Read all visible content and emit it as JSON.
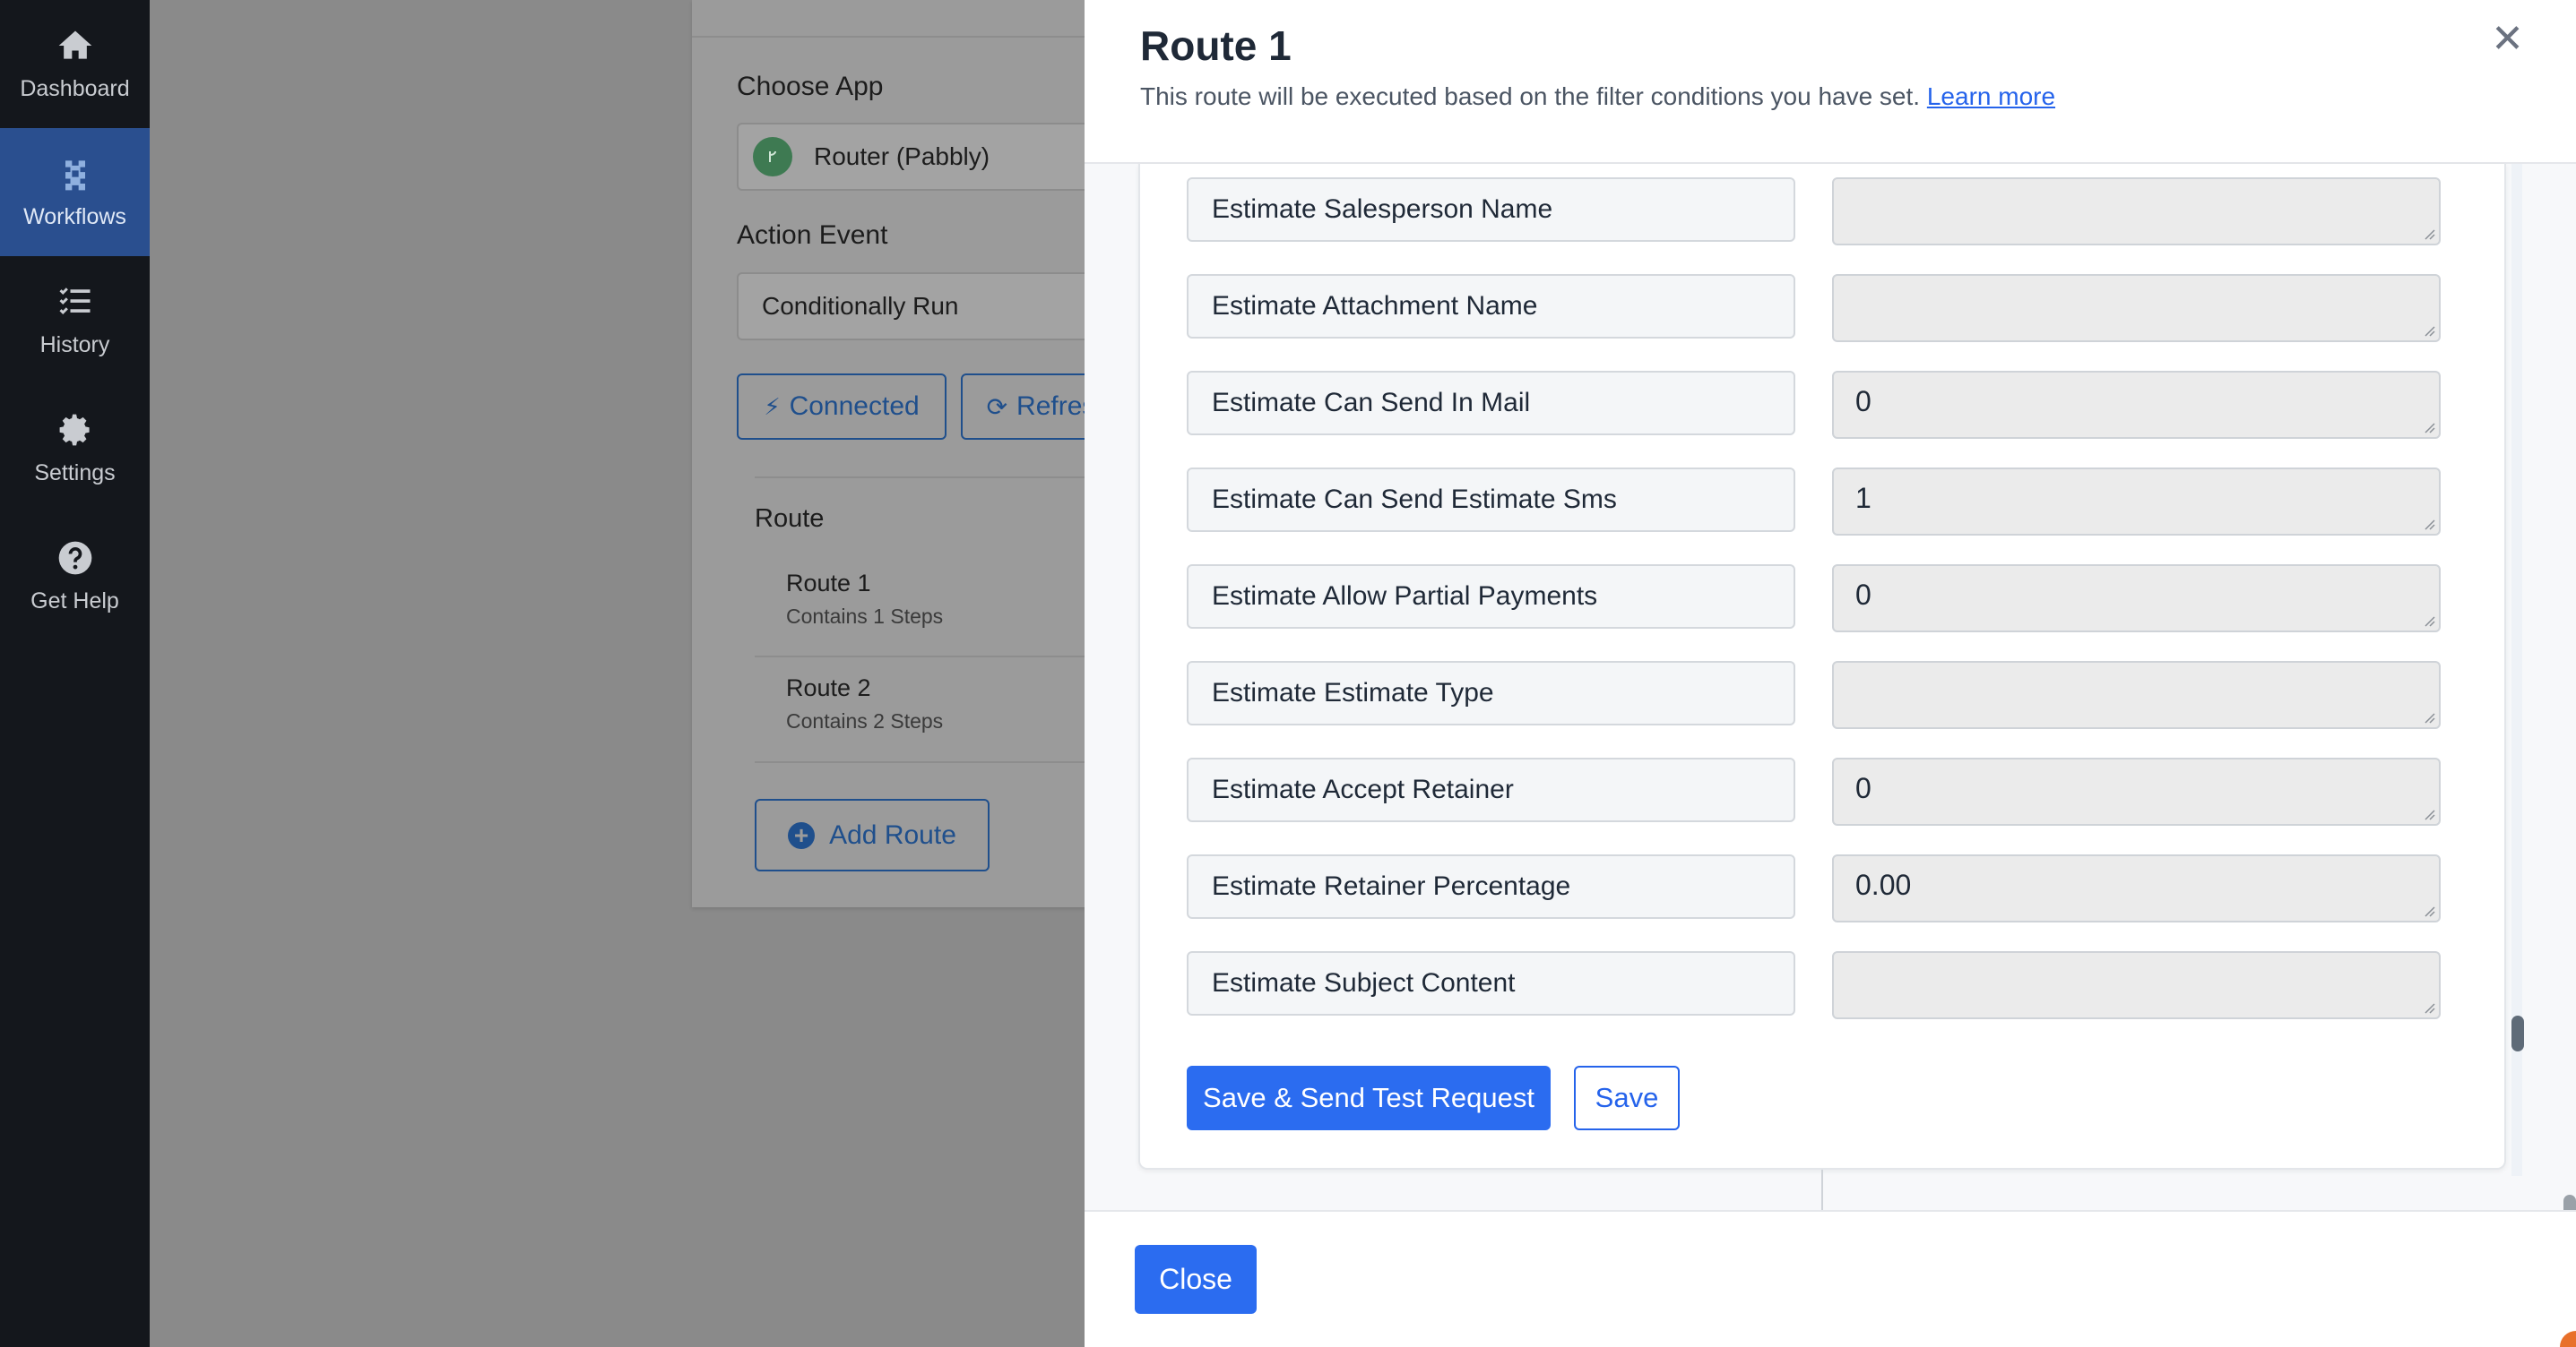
{
  "sidebar": {
    "items": [
      {
        "label": "Dashboard",
        "icon": "home-icon",
        "active": false
      },
      {
        "label": "Workflows",
        "icon": "workflow-icon",
        "active": true
      },
      {
        "label": "History",
        "icon": "history-list-icon",
        "active": false
      },
      {
        "label": "Settings",
        "icon": "gear-icon",
        "active": false
      },
      {
        "label": "Get Help",
        "icon": "help-icon",
        "active": false
      }
    ]
  },
  "background_panel": {
    "choose_app_label": "Choose App",
    "app_value": "Router (Pabbly)",
    "action_event_label": "Action Event",
    "action_event_value": "Conditionally Run",
    "connected_label": "Connected",
    "refresh_label": "Refresh Fields",
    "route_heading": "Route",
    "routes": [
      {
        "title": "Route 1",
        "steps": "Contains 1 Steps"
      },
      {
        "title": "Route 2",
        "steps": "Contains 2 Steps"
      }
    ],
    "add_route_label": "Add Route"
  },
  "modal": {
    "title": "Route 1",
    "subtitle": "This route will be executed based on the filter conditions you have set.",
    "learn_more": "Learn more",
    "fields": [
      {
        "label": "Estimate Salesperson Name",
        "value": ""
      },
      {
        "label": "Estimate Attachment Name",
        "value": ""
      },
      {
        "label": "Estimate Can Send In Mail",
        "value": "0"
      },
      {
        "label": "Estimate Can Send Estimate Sms",
        "value": "1"
      },
      {
        "label": "Estimate Allow Partial Payments",
        "value": "0"
      },
      {
        "label": "Estimate Estimate Type",
        "value": ""
      },
      {
        "label": "Estimate Accept Retainer",
        "value": "0"
      },
      {
        "label": "Estimate Retainer Percentage",
        "value": "0.00"
      },
      {
        "label": "Estimate Subject Content",
        "value": ""
      }
    ],
    "save_test_label": "Save & Send Test Request",
    "save_label": "Save",
    "close_label": "Close"
  },
  "colors": {
    "sidebar_bg": "#14171c",
    "sidebar_active": "#2a4f8f",
    "primary": "#2b6cf0"
  }
}
